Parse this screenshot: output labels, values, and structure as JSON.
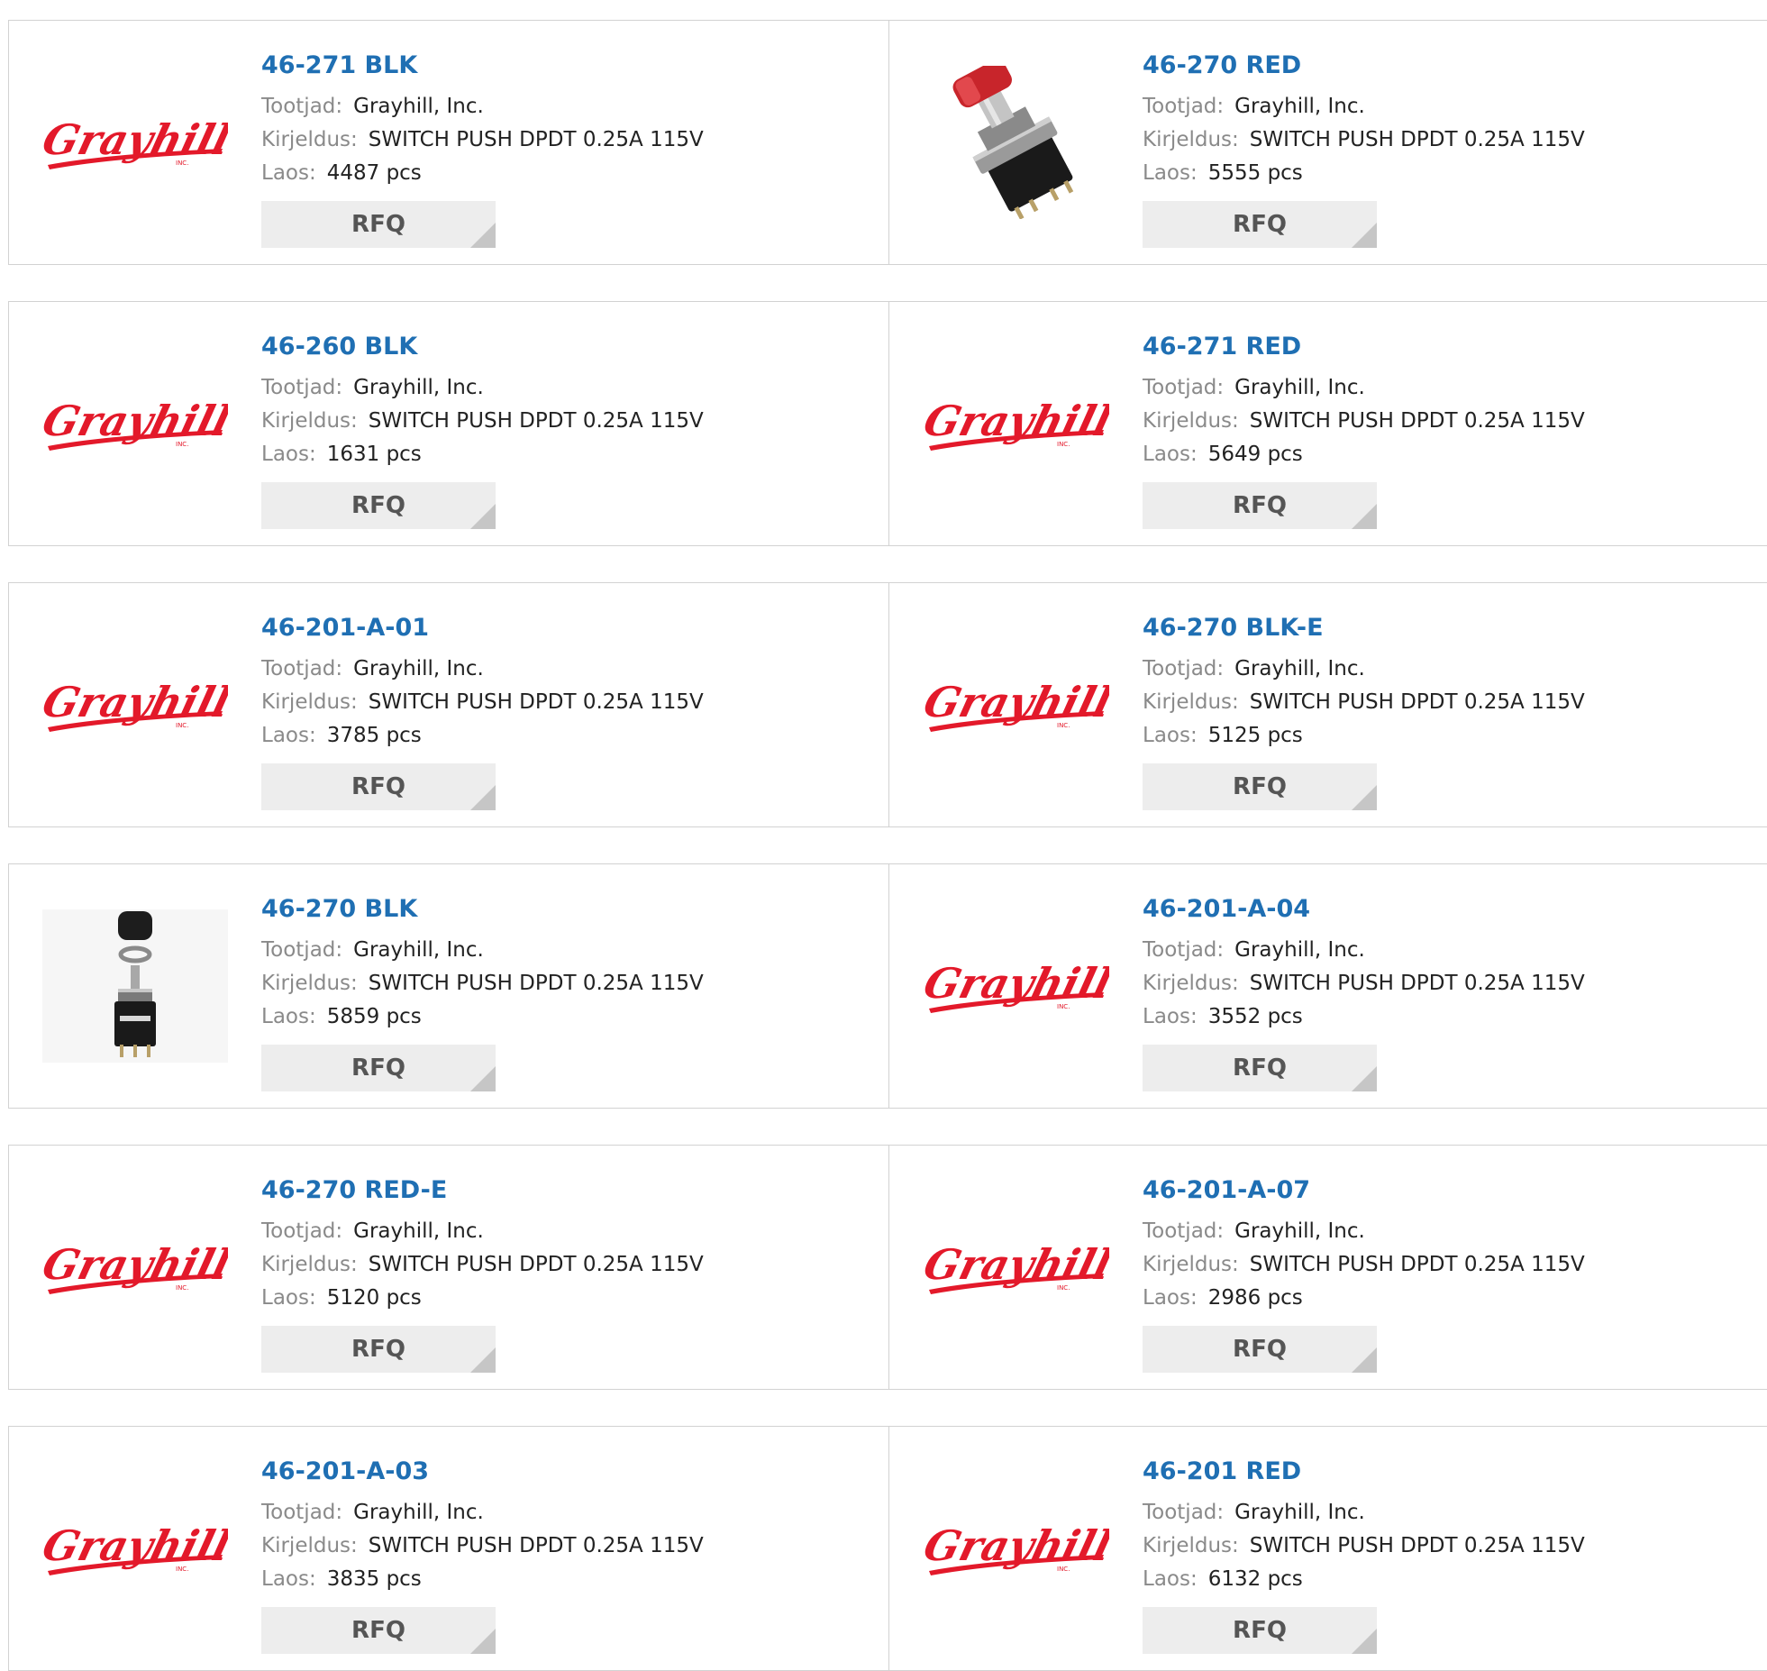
{
  "labels": {
    "manufacturer": "Tootjad:",
    "description": "Kirjeldus:",
    "stock": "Laos:",
    "rfq": "RFQ"
  },
  "brand": {
    "logo_text": "Grayhill",
    "logo_sub": "INC.",
    "logo_color": "#e3192a",
    "link_color": "#1f6fb3"
  },
  "products": [
    {
      "part": "46-271 BLK",
      "manufacturer": "Grayhill, Inc.",
      "description": "SWITCH PUSH DPDT 0.25A 115V",
      "stock": "4487 pcs",
      "image": "grayhill-logo"
    },
    {
      "part": "46-270 RED",
      "manufacturer": "Grayhill, Inc.",
      "description": "SWITCH PUSH DPDT 0.25A 115V",
      "stock": "5555 pcs",
      "image": "push-switch-red-photo"
    },
    {
      "part": "46-260 BLK",
      "manufacturer": "Grayhill, Inc.",
      "description": "SWITCH PUSH DPDT 0.25A 115V",
      "stock": "1631 pcs",
      "image": "grayhill-logo"
    },
    {
      "part": "46-271 RED",
      "manufacturer": "Grayhill, Inc.",
      "description": "SWITCH PUSH DPDT 0.25A 115V",
      "stock": "5649 pcs",
      "image": "grayhill-logo"
    },
    {
      "part": "46-201-A-01",
      "manufacturer": "Grayhill, Inc.",
      "description": "SWITCH PUSH DPDT 0.25A 115V",
      "stock": "3785 pcs",
      "image": "grayhill-logo"
    },
    {
      "part": "46-270 BLK-E",
      "manufacturer": "Grayhill, Inc.",
      "description": "SWITCH PUSH DPDT 0.25A 115V",
      "stock": "5125 pcs",
      "image": "grayhill-logo"
    },
    {
      "part": "46-270 BLK",
      "manufacturer": "Grayhill, Inc.",
      "description": "SWITCH PUSH DPDT 0.25A 115V",
      "stock": "5859 pcs",
      "image": "push-switch-black-photo"
    },
    {
      "part": "46-201-A-04",
      "manufacturer": "Grayhill, Inc.",
      "description": "SWITCH PUSH DPDT 0.25A 115V",
      "stock": "3552 pcs",
      "image": "grayhill-logo"
    },
    {
      "part": "46-270 RED-E",
      "manufacturer": "Grayhill, Inc.",
      "description": "SWITCH PUSH DPDT 0.25A 115V",
      "stock": "5120 pcs",
      "image": "grayhill-logo"
    },
    {
      "part": "46-201-A-07",
      "manufacturer": "Grayhill, Inc.",
      "description": "SWITCH PUSH DPDT 0.25A 115V",
      "stock": "2986 pcs",
      "image": "grayhill-logo"
    },
    {
      "part": "46-201-A-03",
      "manufacturer": "Grayhill, Inc.",
      "description": "SWITCH PUSH DPDT 0.25A 115V",
      "stock": "3835 pcs",
      "image": "grayhill-logo"
    },
    {
      "part": "46-201 RED",
      "manufacturer": "Grayhill, Inc.",
      "description": "SWITCH PUSH DPDT 0.25A 115V",
      "stock": "6132 pcs",
      "image": "grayhill-logo"
    }
  ]
}
